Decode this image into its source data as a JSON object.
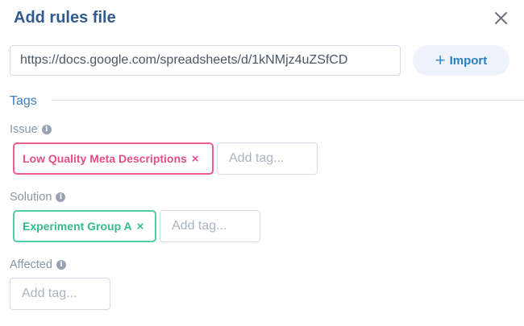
{
  "dialog": {
    "title": "Add rules file",
    "close_icon": "close-icon"
  },
  "url_input": {
    "value": "https://docs.google.com/spreadsheets/d/1kNMjz4uZSfCD"
  },
  "import_button": {
    "icon": "plus-icon",
    "icon_glyph": "+",
    "label": "Import"
  },
  "tags_section": {
    "label": "Tags"
  },
  "fields": {
    "issue": {
      "label": "Issue",
      "info_icon": "i",
      "tags": [
        {
          "label": "Low Quality Meta Descriptions",
          "remove_glyph": "×",
          "color": "#ec5d92"
        }
      ],
      "placeholder": "Add tag..."
    },
    "solution": {
      "label": "Solution",
      "info_icon": "i",
      "tags": [
        {
          "label": "Experiment Group A",
          "remove_glyph": "×",
          "color": "#4fcca8"
        }
      ],
      "placeholder": "Add tag..."
    },
    "affected": {
      "label": "Affected",
      "info_icon": "i",
      "placeholder": "Add tag..."
    }
  },
  "colors": {
    "title": "#2f5b8e",
    "accent": "#2a7fbf",
    "issue_tag": "#ec5d92",
    "solution_tag": "#4fcca8"
  }
}
